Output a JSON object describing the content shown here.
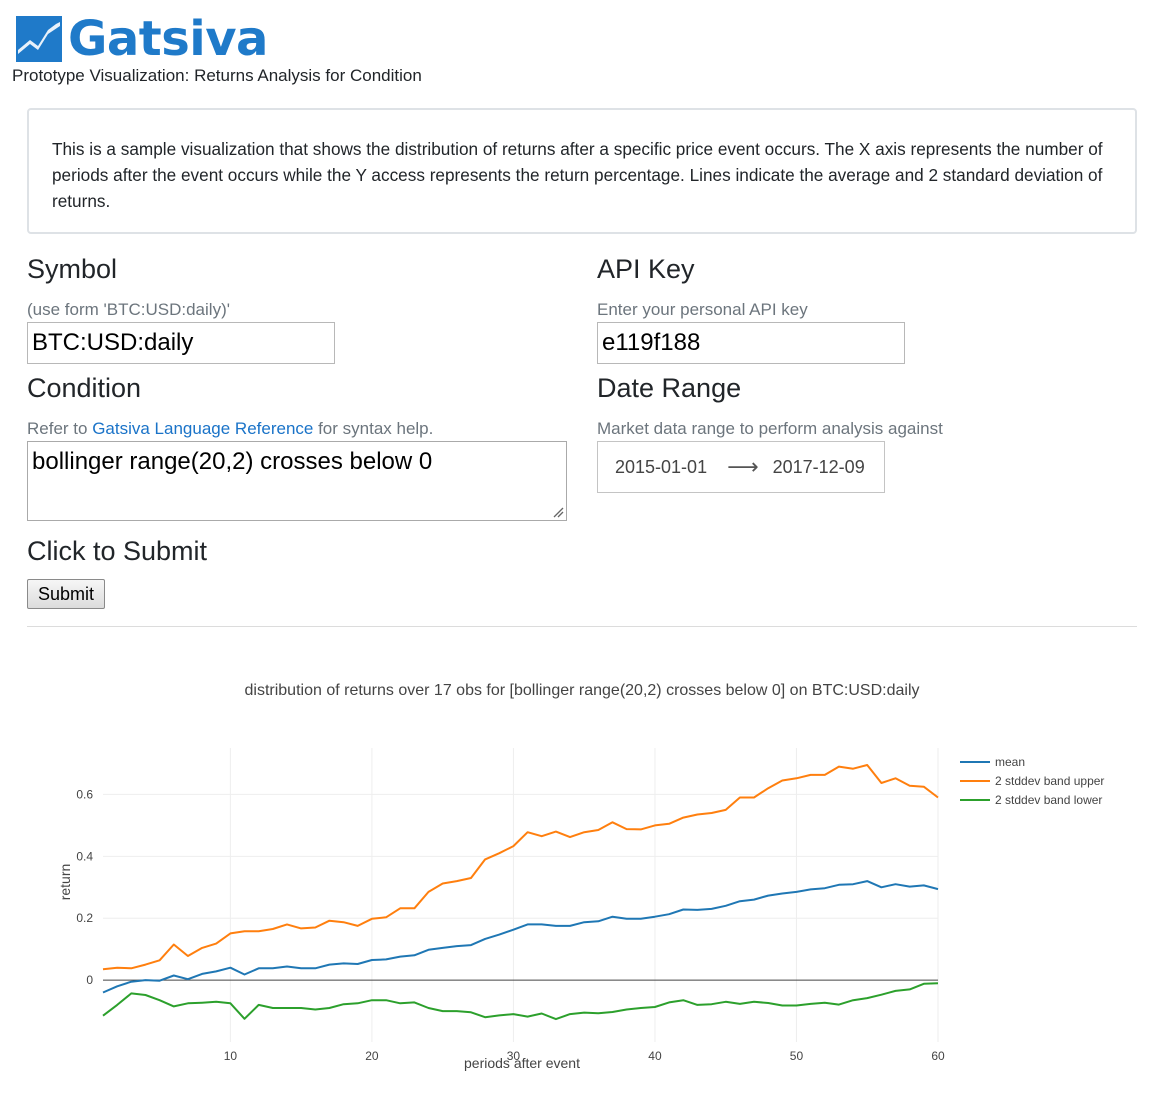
{
  "brand": {
    "name": "Gatsiva"
  },
  "subtitle": "Prototype Visualization: Returns Analysis for Condition",
  "description": "This is a sample visualization that shows the distribution of returns after a specific price event occurs. The X axis represents the number of periods after the event occurs while the Y access represents the return percentage. Lines indicate the average and 2 standard deviation of returns.",
  "symbol": {
    "heading": "Symbol",
    "hint": "(use form 'BTC:USD:daily)'",
    "value": "BTC:USD:daily"
  },
  "api_key": {
    "heading": "API Key",
    "hint": "Enter your personal API key",
    "value": "e119f188"
  },
  "condition": {
    "heading": "Condition",
    "hint_prefix": "Refer to ",
    "hint_link": "Gatsiva Language Reference",
    "hint_suffix": " for syntax help.",
    "value": "bollinger range(20,2) crosses below 0"
  },
  "date_range": {
    "heading": "Date Range",
    "hint": "Market data range to perform analysis against",
    "start": "2015-01-01",
    "end": "2017-12-09"
  },
  "submit": {
    "heading": "Click to Submit",
    "button_label": "Submit"
  },
  "colors": {
    "brand": "#1f7ac9",
    "link": "#1a73c8",
    "mean": "#1f77b4",
    "upper": "#ff7f0e",
    "lower": "#2ca02c"
  },
  "chart_data": {
    "type": "line",
    "title": "distribution of returns over 17 obs for [bollinger range(20,2) crosses below 0] on BTC:USD:daily",
    "xlabel": "periods after event",
    "ylabel": "return",
    "xlim": [
      1,
      60
    ],
    "ylim": [
      -0.2,
      0.75
    ],
    "xticks": [
      10,
      20,
      30,
      40,
      50,
      60
    ],
    "yticks": [
      0,
      0.2,
      0.4,
      0.6
    ],
    "ytick_labels": [
      "0",
      "0.2",
      "0.4",
      "0.6"
    ],
    "grid": true,
    "legend": "right",
    "x": [
      1,
      2,
      3,
      4,
      5,
      6,
      7,
      8,
      9,
      10,
      11,
      12,
      13,
      14,
      15,
      16,
      17,
      18,
      19,
      20,
      21,
      22,
      23,
      24,
      25,
      26,
      27,
      28,
      29,
      30,
      31,
      32,
      33,
      34,
      35,
      36,
      37,
      38,
      39,
      40,
      41,
      42,
      43,
      44,
      45,
      46,
      47,
      48,
      49,
      50,
      51,
      52,
      53,
      54,
      55,
      56,
      57,
      58,
      59,
      60
    ],
    "series": [
      {
        "name": "mean",
        "color": "#1f77b4",
        "values": [
          -0.04,
          -0.02,
          -0.005,
          0,
          -0.002,
          0.015,
          0.003,
          0.02,
          0.028,
          0.04,
          0.018,
          0.038,
          0.038,
          0.044,
          0.038,
          0.038,
          0.05,
          0.054,
          0.052,
          0.065,
          0.067,
          0.076,
          0.08,
          0.098,
          0.104,
          0.11,
          0.113,
          0.133,
          0.147,
          0.163,
          0.18,
          0.18,
          0.175,
          0.175,
          0.187,
          0.19,
          0.205,
          0.198,
          0.198,
          0.205,
          0.213,
          0.228,
          0.227,
          0.23,
          0.24,
          0.255,
          0.26,
          0.273,
          0.28,
          0.285,
          0.293,
          0.297,
          0.308,
          0.31,
          0.32,
          0.3,
          0.31,
          0.302,
          0.306,
          0.294
        ]
      },
      {
        "name": "2 stddev band upper",
        "color": "#ff7f0e",
        "values": [
          0.035,
          0.04,
          0.038,
          0.05,
          0.064,
          0.115,
          0.078,
          0.104,
          0.118,
          0.151,
          0.158,
          0.158,
          0.165,
          0.18,
          0.167,
          0.17,
          0.192,
          0.187,
          0.175,
          0.198,
          0.203,
          0.232,
          0.232,
          0.285,
          0.312,
          0.32,
          0.33,
          0.39,
          0.41,
          0.433,
          0.478,
          0.465,
          0.48,
          0.462,
          0.478,
          0.485,
          0.51,
          0.488,
          0.487,
          0.5,
          0.505,
          0.525,
          0.535,
          0.54,
          0.55,
          0.59,
          0.59,
          0.62,
          0.645,
          0.652,
          0.663,
          0.663,
          0.69,
          0.683,
          0.695,
          0.637,
          0.652,
          0.628,
          0.625,
          0.59
        ]
      },
      {
        "name": "2 stddev band lower",
        "color": "#2ca02c",
        "values": [
          -0.115,
          -0.08,
          -0.043,
          -0.048,
          -0.065,
          -0.085,
          -0.075,
          -0.073,
          -0.07,
          -0.075,
          -0.125,
          -0.08,
          -0.09,
          -0.09,
          -0.09,
          -0.095,
          -0.09,
          -0.078,
          -0.075,
          -0.065,
          -0.065,
          -0.075,
          -0.072,
          -0.09,
          -0.1,
          -0.1,
          -0.104,
          -0.12,
          -0.114,
          -0.11,
          -0.118,
          -0.108,
          -0.126,
          -0.11,
          -0.105,
          -0.107,
          -0.103,
          -0.095,
          -0.09,
          -0.087,
          -0.072,
          -0.065,
          -0.08,
          -0.078,
          -0.07,
          -0.077,
          -0.07,
          -0.074,
          -0.082,
          -0.082,
          -0.077,
          -0.073,
          -0.079,
          -0.065,
          -0.058,
          -0.047,
          -0.035,
          -0.03,
          -0.012,
          -0.01
        ]
      }
    ]
  }
}
